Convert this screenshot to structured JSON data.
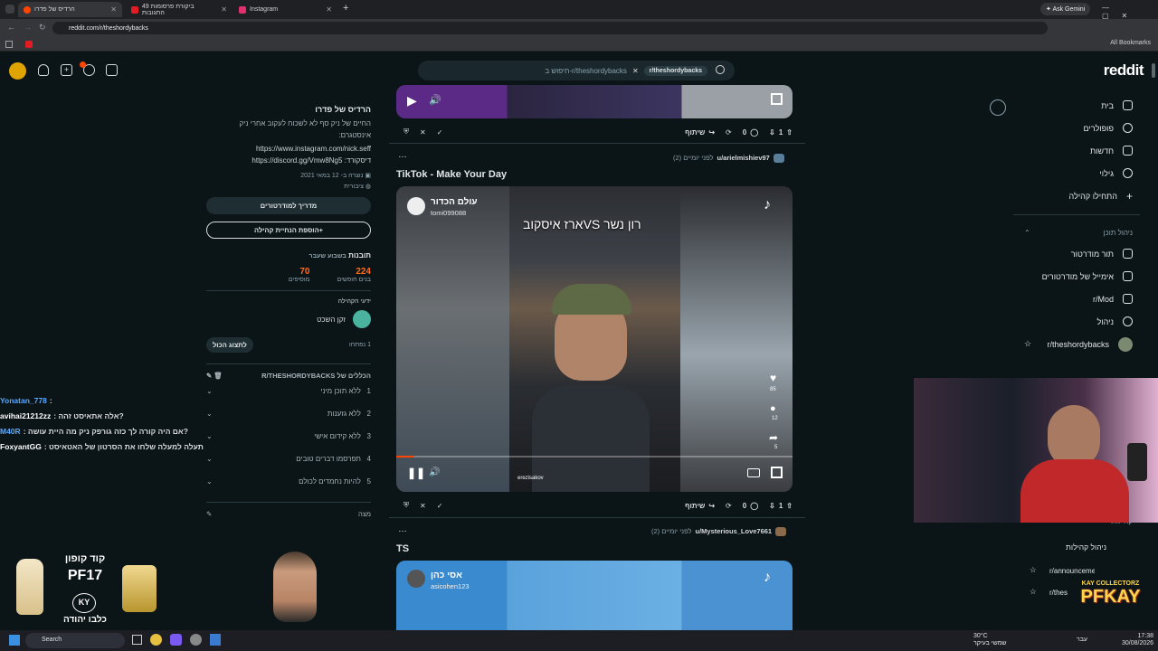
{
  "browser": {
    "tabs": [
      {
        "label": "הרדיס של פדרו",
        "active": true,
        "color": "#ff4500"
      },
      {
        "label": "ביקורת פרסומות 49 התגובות",
        "active": false,
        "color": "#e31b23"
      },
      {
        "label": "Instagram",
        "active": false,
        "color": "#e1306c"
      }
    ],
    "new_tab": "+",
    "ask_gemini": "Ask Gemini",
    "url": "reddit.com/r/theshordybacks",
    "all_bookmarks": "All Bookmarks"
  },
  "reddit": {
    "logo": "reddit",
    "search_chip": "r/theshordybacks",
    "search_placeholder": "חיפוש ב-r/theshordybacks"
  },
  "right_nav": {
    "items": [
      {
        "label": "בית",
        "icon": "home-icon"
      },
      {
        "label": "פופולרים",
        "icon": "popular-icon"
      },
      {
        "label": "חדשות",
        "icon": "news-icon"
      },
      {
        "label": "גילוי",
        "icon": "explore-icon"
      },
      {
        "label": "התחילו קהילה",
        "icon": "plus-icon"
      }
    ],
    "content_mgmt_heading": "ניהול תוכן",
    "mod_items": [
      {
        "label": "תור מודרטור",
        "icon": "queue-icon"
      },
      {
        "label": "אימייל של מודרטורים",
        "icon": "mail-icon"
      },
      {
        "label": "r/Mod",
        "icon": "mod-icon"
      },
      {
        "label": "ניהול",
        "icon": "gear-icon"
      },
      {
        "label": "r/theshordybacks",
        "icon": "star-icon"
      }
    ],
    "communities_heading": "קהילות",
    "manage_communities": "ניהול קהילות",
    "announcements": "r/announcements",
    "sub2": "r/thes"
  },
  "sidebar": {
    "title": "הרדיס של פדרו",
    "desc": "החיים של ניק סף לא לשכוח לעקוב אחרי ניק אינסטגרם:",
    "insta": "https://www.instagram.com/nick.seff",
    "discord": "דיסקורד: https://discord.gg/Vmw8Ng5",
    "created": "נוצרה ב- 12 במאי 2021",
    "public": "ציבורית",
    "mod_guide": "מדריך למודרטורים",
    "add_widget": "הוספת הנחיית קהילה",
    "stats_label": "תובנות",
    "stats_period": "בשבוע שעבר",
    "visitors_num": "224",
    "visitors_label": "בנים חופשים",
    "contrib_num": "70",
    "contrib_label": "מוסיפים",
    "friends_label": "ידעי הקהילה",
    "friend_name": "זקן השכט",
    "show_all": "לתצוג הכול",
    "one_closed": "1 נפתחו",
    "rules_heading": "הכללים של R/THESHORDYBACKS",
    "rules": [
      {
        "n": "1",
        "t": "ללא תוכן מיני"
      },
      {
        "n": "2",
        "t": "ללא גזענות"
      },
      {
        "n": "3",
        "t": "ללא קידום אישי"
      },
      {
        "n": "4",
        "t": "תפרסמו דברים טובים"
      },
      {
        "n": "5",
        "t": "להיות נחמדים לכולם"
      }
    ],
    "bottom_label": "מצה"
  },
  "posts": [
    {
      "author": "u/arielmishiev97",
      "time": "לפני יומיים (2)",
      "title": "TikTok - Make Your Day",
      "video_channel": "עולם הכדור",
      "video_handle": "tomi099088",
      "video_caption": "ארז איסקובVS רון נשר",
      "video_user": "erezisakov",
      "comments": "0",
      "votes": "1",
      "share": "שיתוף"
    },
    {
      "author": "u/Mysterious_Love7661",
      "time": "לפני יומיים (2)",
      "title": "TS",
      "video_channel": "אסי כהן",
      "video_handle": "asicohen123",
      "comments": "0",
      "votes": "1",
      "share": "שיתוף"
    }
  ],
  "top_action": {
    "comments": "0",
    "votes": "1",
    "share": "שיתוף"
  },
  "tiktok_counts": {
    "likes": "85",
    "comments": "12",
    "shares": "5"
  },
  "chat": [
    {
      "user": "Yonatan_778",
      "msg": ":",
      "color": "#5aa9ff"
    },
    {
      "user": "avihai21212zz",
      "msg": ": אלה אתאיסט זהה?",
      "color": "#ffffff"
    },
    {
      "user": "M40R",
      "msg": ": אם היה קורה לך כזה גורפק ניק מה היית עושה?",
      "color": "#5aa9ff"
    },
    {
      "user": "FoxyantGG",
      "msg": ": תעלה למעלה שלחו את הסרטון של האטאיסט",
      "color": "#ffffff"
    }
  ],
  "promo": {
    "code": "קוד קופון",
    "coupon": "PF17",
    "brand": "כלבו יהודה",
    "badge": "KY"
  },
  "overlay_logo": {
    "top": "KAY COLLECTORZ",
    "main": "PFKAY"
  },
  "taskbar": {
    "search": "Search",
    "weather_temp": "30°C",
    "weather_desc": "שמשי בעיקר",
    "time": "17:38",
    "date": "30/08/2026",
    "lang": "עבר"
  }
}
